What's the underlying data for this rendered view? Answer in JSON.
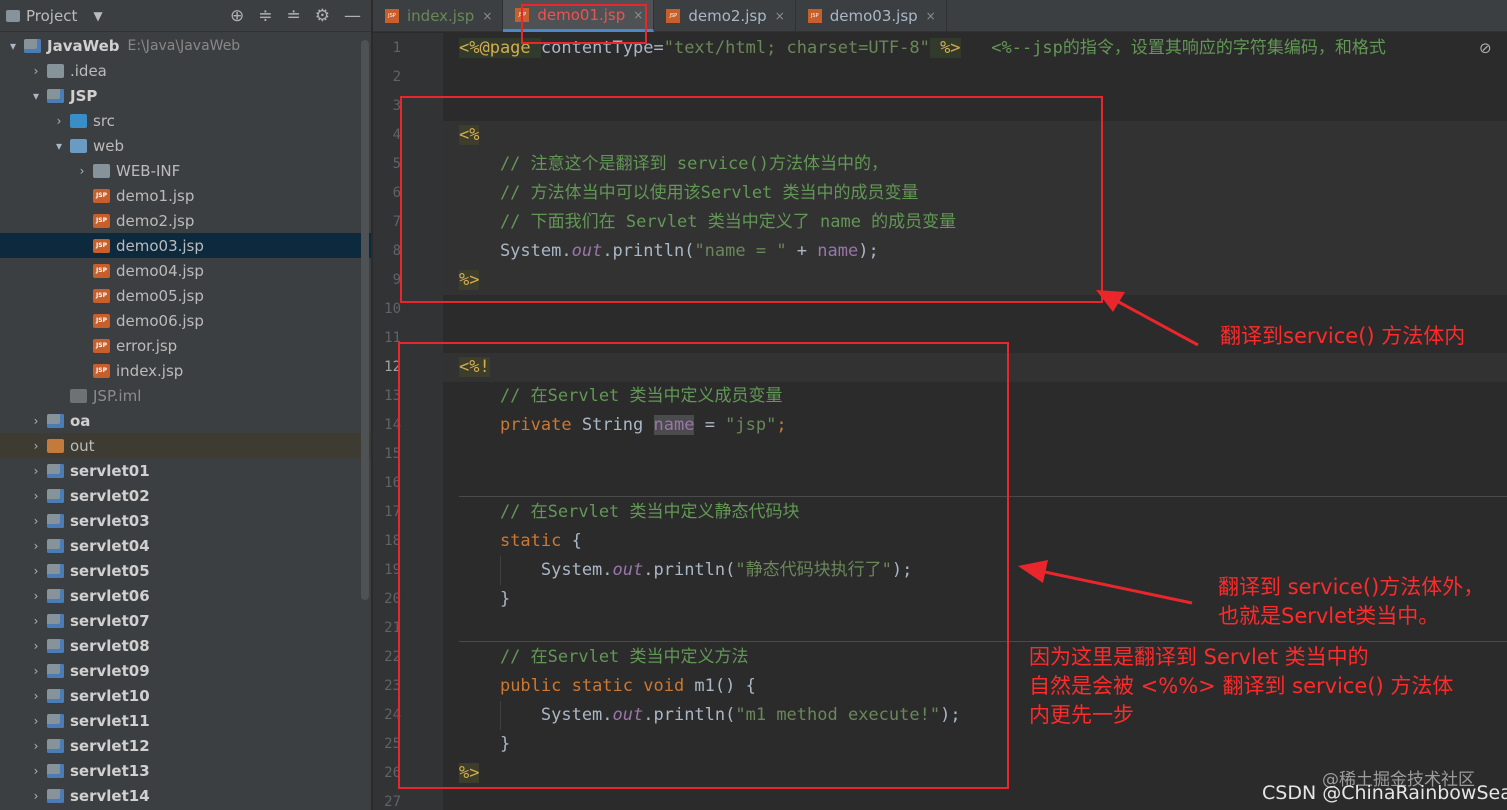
{
  "project_panel": {
    "title": "Project",
    "tree": [
      {
        "label": "JavaWeb",
        "path": "E:\\Java\\JavaWeb",
        "indent": 0,
        "arrow": "▾",
        "icon": "module",
        "bold": true
      },
      {
        "label": ".idea",
        "indent": 1,
        "arrow": "›",
        "icon": "folder"
      },
      {
        "label": "JSP",
        "indent": 1,
        "arrow": "▾",
        "icon": "module",
        "bold": true
      },
      {
        "label": "src",
        "indent": 2,
        "arrow": "›",
        "icon": "folder-blue"
      },
      {
        "label": "web",
        "indent": 2,
        "arrow": "▾",
        "icon": "folder-web"
      },
      {
        "label": "WEB-INF",
        "indent": 3,
        "arrow": "›",
        "icon": "folder"
      },
      {
        "label": "demo1.jsp",
        "indent": 3,
        "arrow": "",
        "icon": "jsp"
      },
      {
        "label": "demo2.jsp",
        "indent": 3,
        "arrow": "",
        "icon": "jsp"
      },
      {
        "label": "demo03.jsp",
        "indent": 3,
        "arrow": "",
        "icon": "jsp",
        "selected": true
      },
      {
        "label": "demo04.jsp",
        "indent": 3,
        "arrow": "",
        "icon": "jsp"
      },
      {
        "label": "demo05.jsp",
        "indent": 3,
        "arrow": "",
        "icon": "jsp"
      },
      {
        "label": "demo06.jsp",
        "indent": 3,
        "arrow": "",
        "icon": "jsp"
      },
      {
        "label": "error.jsp",
        "indent": 3,
        "arrow": "",
        "icon": "jsp"
      },
      {
        "label": "index.jsp",
        "indent": 3,
        "arrow": "",
        "icon": "jsp"
      },
      {
        "label": "JSP.iml",
        "indent": 2,
        "arrow": "",
        "icon": "iml",
        "muted": true
      },
      {
        "label": "oa",
        "indent": 1,
        "arrow": "›",
        "icon": "module",
        "bold": true
      },
      {
        "label": "out",
        "indent": 1,
        "arrow": "›",
        "icon": "folder-orange",
        "out": true
      },
      {
        "label": "servlet01",
        "indent": 1,
        "arrow": "›",
        "icon": "module",
        "bold": true
      },
      {
        "label": "servlet02",
        "indent": 1,
        "arrow": "›",
        "icon": "module",
        "bold": true
      },
      {
        "label": "servlet03",
        "indent": 1,
        "arrow": "›",
        "icon": "module",
        "bold": true
      },
      {
        "label": "servlet04",
        "indent": 1,
        "arrow": "›",
        "icon": "module",
        "bold": true
      },
      {
        "label": "servlet05",
        "indent": 1,
        "arrow": "›",
        "icon": "module",
        "bold": true
      },
      {
        "label": "servlet06",
        "indent": 1,
        "arrow": "›",
        "icon": "module",
        "bold": true
      },
      {
        "label": "servlet07",
        "indent": 1,
        "arrow": "›",
        "icon": "module",
        "bold": true
      },
      {
        "label": "servlet08",
        "indent": 1,
        "arrow": "›",
        "icon": "module",
        "bold": true
      },
      {
        "label": "servlet09",
        "indent": 1,
        "arrow": "›",
        "icon": "module",
        "bold": true
      },
      {
        "label": "servlet10",
        "indent": 1,
        "arrow": "›",
        "icon": "module",
        "bold": true
      },
      {
        "label": "servlet11",
        "indent": 1,
        "arrow": "›",
        "icon": "module",
        "bold": true
      },
      {
        "label": "servlet12",
        "indent": 1,
        "arrow": "›",
        "icon": "module",
        "bold": true
      },
      {
        "label": "servlet13",
        "indent": 1,
        "arrow": "›",
        "icon": "module",
        "bold": true
      },
      {
        "label": "servlet14",
        "indent": 1,
        "arrow": "›",
        "icon": "module",
        "bold": true
      }
    ]
  },
  "tabs": [
    {
      "label": "index.jsp",
      "style": "green"
    },
    {
      "label": "demo01.jsp",
      "style": "active"
    },
    {
      "label": "demo2.jsp",
      "style": ""
    },
    {
      "label": "demo03.jsp",
      "style": ""
    }
  ],
  "tab_close_glyph": "×",
  "jsp_icon_text": "JSP",
  "editor": {
    "current_line": 12,
    "line_numbers": [
      "1",
      "2",
      "3",
      "4",
      "5",
      "6",
      "7",
      "8",
      "9",
      "10",
      "11",
      "12",
      "13",
      "14",
      "15",
      "16",
      "17",
      "18",
      "19",
      "20",
      "21",
      "22",
      "23",
      "24",
      "25",
      "26",
      "27"
    ],
    "code_lines": [
      [
        {
          "t": "<%@page ",
          "c": "dir"
        },
        {
          "t": "contentType=",
          "c": ""
        },
        {
          "t": "\"text/html; charset=UTF-8\"",
          "c": "str"
        },
        {
          "t": " %>",
          "c": "dir"
        },
        {
          "t": "   <%--jsp的指令，设置其响应的字符集编码，和格式",
          "c": "cm"
        }
      ],
      [],
      [],
      [
        {
          "t": "<%",
          "c": "pct"
        }
      ],
      [
        {
          "t": "    // 注意这个是翻译到 service()方法体当中的，",
          "c": "cm"
        }
      ],
      [
        {
          "t": "    // 方法体当中可以使用该Servlet 类当中的成员变量",
          "c": "cm"
        }
      ],
      [
        {
          "t": "    // 下面我们在 Servlet 类当中定义了 name 的成员变量",
          "c": "cm"
        }
      ],
      [
        {
          "t": "    System.",
          "c": ""
        },
        {
          "t": "out",
          "c": "ital"
        },
        {
          "t": ".println(",
          "c": ""
        },
        {
          "t": "\"name = \"",
          "c": "str"
        },
        {
          "t": " + ",
          "c": ""
        },
        {
          "t": "name",
          "c": "fld"
        },
        {
          "t": ");",
          "c": ""
        }
      ],
      [
        {
          "t": "%>",
          "c": "pct"
        }
      ],
      [],
      [],
      [
        {
          "t": "<%!",
          "c": "pct"
        }
      ],
      [
        {
          "t": "    // 在Servlet 类当中定义成员变量",
          "c": "cm"
        }
      ],
      [
        {
          "t": "    ",
          "c": ""
        },
        {
          "t": "private ",
          "c": "kw"
        },
        {
          "t": "String ",
          "c": ""
        },
        {
          "t": "name",
          "c": "name-hl"
        },
        {
          "t": " = ",
          "c": ""
        },
        {
          "t": "\"jsp\"",
          "c": "str"
        },
        {
          "t": ";",
          "c": "kw"
        }
      ],
      [],
      [],
      [
        {
          "t": "    // 在Servlet 类当中定义静态代码块",
          "c": "cm"
        }
      ],
      [
        {
          "t": "    ",
          "c": ""
        },
        {
          "t": "static ",
          "c": "kw"
        },
        {
          "t": "{",
          "c": ""
        }
      ],
      [
        {
          "t": "        System.",
          "c": ""
        },
        {
          "t": "out",
          "c": "ital"
        },
        {
          "t": ".println(",
          "c": ""
        },
        {
          "t": "\"静态代码块执行了\"",
          "c": "str"
        },
        {
          "t": ");",
          "c": ""
        }
      ],
      [
        {
          "t": "    }",
          "c": ""
        }
      ],
      [],
      [
        {
          "t": "    // 在Servlet 类当中定义方法",
          "c": "cm"
        }
      ],
      [
        {
          "t": "    ",
          "c": ""
        },
        {
          "t": "public static void ",
          "c": "kw"
        },
        {
          "t": "m1",
          "c": ""
        },
        {
          "t": "() {",
          "c": ""
        }
      ],
      [
        {
          "t": "        System.",
          "c": ""
        },
        {
          "t": "out",
          "c": "ital"
        },
        {
          "t": ".println(",
          "c": ""
        },
        {
          "t": "\"m1 method execute!\"",
          "c": "str"
        },
        {
          "t": ");",
          "c": ""
        }
      ],
      [
        {
          "t": "    }",
          "c": ""
        }
      ],
      [
        {
          "t": "%>",
          "c": "pct"
        }
      ],
      []
    ]
  },
  "annotations": {
    "note1": "翻译到service() 方法体内",
    "note2_line1": "翻译到 service()方法体外，",
    "note2_line2": "也就是Servlet类当中。",
    "note3_line1": "因为这里是翻译到 Servlet 类当中的",
    "note3_line2": "自然是会被 <%%> 翻译到 service() 方法体",
    "note3_line3": "内更先一步"
  },
  "watermarks": {
    "juejin": "@稀土掘金技术社区",
    "csdn": "CSDN @ChinaRainbowSea"
  },
  "colors": {
    "annotation_red": "#e8262b",
    "tab_active_text": "#ef5350",
    "comment_green": "#629755"
  }
}
